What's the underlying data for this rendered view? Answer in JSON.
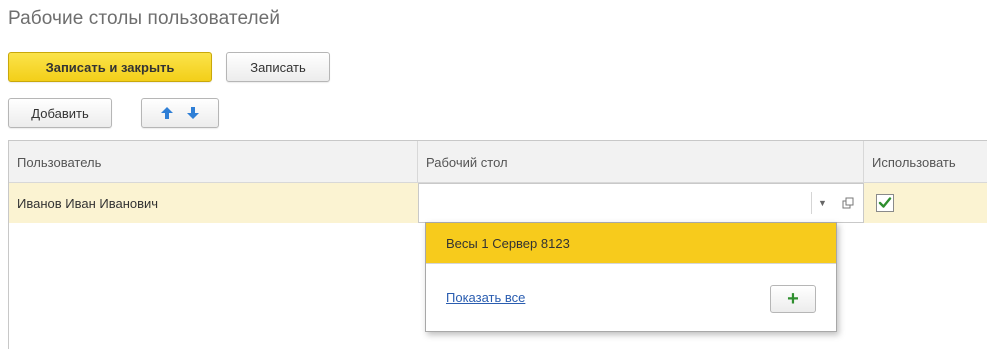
{
  "window": {
    "title": "Рабочие столы пользователей"
  },
  "toolbar": {
    "save_close_label": "Записать и закрыть",
    "save_label": "Записать",
    "add_label": "Добавить",
    "move_up_icon": "arrow-up-icon",
    "move_down_icon": "arrow-down-icon"
  },
  "table": {
    "columns": [
      "Пользователь",
      "Рабочий стол",
      "Использовать"
    ],
    "rows": [
      {
        "user": "Иванов Иван Иванович",
        "desktop": "",
        "use": true
      }
    ]
  },
  "dropdown": {
    "options": [
      "Весы 1 Сервер 8123"
    ],
    "show_all_label": "Показать все",
    "add_icon": "plus-icon"
  },
  "colors": {
    "accent": "#f3cf19",
    "selected_row": "#fbf3d2",
    "highlight_option": "#f7cb1c",
    "link": "#2a5db0",
    "check": "#2f8f2f"
  }
}
